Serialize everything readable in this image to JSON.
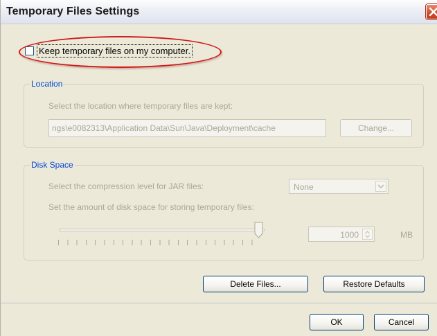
{
  "window": {
    "title": "Temporary Files Settings"
  },
  "keep_files": {
    "label": "Keep temporary files on my computer.",
    "checked": false
  },
  "location": {
    "title": "Location",
    "description": "Select the location where temporary files are kept:",
    "path_value": "ngs\\e0082313\\Application Data\\Sun\\Java\\Deployment\\cache",
    "change_label": "Change..."
  },
  "disk_space": {
    "title": "Disk Space",
    "compression_label": "Select the compression level for JAR files:",
    "compression_value": "None",
    "amount_label": "Set the amount of disk space for storing temporary files:",
    "slider_level": 1.0,
    "spinner_value": "1000",
    "unit": "MB"
  },
  "actions": {
    "delete_label": "Delete Files...",
    "restore_label": "Restore Defaults",
    "ok_label": "OK",
    "cancel_label": "Cancel"
  },
  "colors": {
    "group_title": "#0046d5",
    "highlight": "#d01818",
    "close_button": "#d4532f"
  },
  "icons": [
    "close-icon",
    "checkbox",
    "spinner-arrows-icon",
    "dropdown-arrow-icon",
    "slider-thumb"
  ]
}
